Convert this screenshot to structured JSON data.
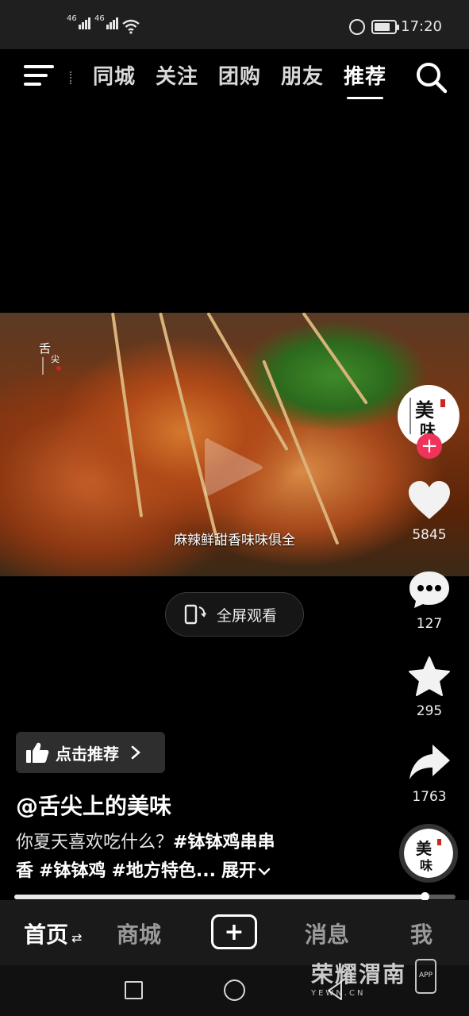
{
  "status_bar": {
    "signal_1": "46",
    "signal_2": "46",
    "time": "17:20",
    "battery_level": 0.8,
    "icons": [
      "signal-icon",
      "wifi-icon",
      "alarm-icon",
      "battery-icon"
    ]
  },
  "top_nav": {
    "tabs": [
      {
        "label": "同城"
      },
      {
        "label": "关注"
      },
      {
        "label": "团购"
      },
      {
        "label": "朋友"
      },
      {
        "label": "推荐",
        "active": true
      }
    ]
  },
  "video": {
    "subtitle": "麻辣鲜甜香味味俱全",
    "fullscreen_label": "全屏观看"
  },
  "rail": {
    "likes": "5845",
    "comments": "127",
    "favorites": "295",
    "shares": "1763"
  },
  "caption": {
    "recommend_label": "点击推荐",
    "author": "@舌尖上的美味",
    "desc_plain": "你夏天喜欢吃什么？",
    "tag_1": "#钵钵鸡串串",
    "tag_1b": "香",
    "tag_2": "#钵钵鸡",
    "tag_3": "#地方特色...",
    "expand": "展开"
  },
  "progress": 0.93,
  "bottom_tabs": {
    "home": "首页",
    "mall": "商城",
    "create": "+",
    "messages": "消息",
    "me": "我"
  },
  "watermark": {
    "title": "荣耀渭南",
    "url": "YEWN.CN",
    "app": "APP"
  },
  "colors": {
    "accent_pink": "#f0335b",
    "background": "#000000",
    "tab_bar": "#1a1a1a"
  }
}
